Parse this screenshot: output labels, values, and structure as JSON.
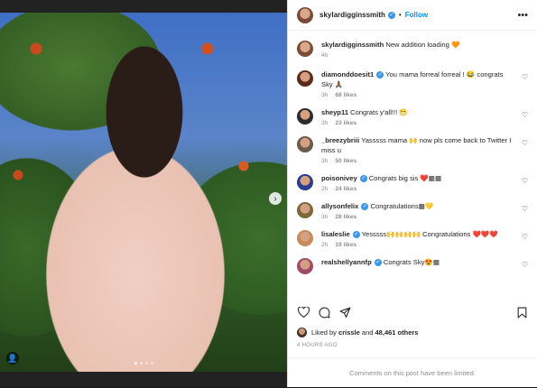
{
  "post": {
    "username": "skylardigginssmith",
    "follow_label": "Follow",
    "dot": "•",
    "more": "•••"
  },
  "caption": {
    "username": "skylardigginssmith",
    "text": "New addition loading 🧡",
    "time": "4h"
  },
  "comments": [
    {
      "username": "diamonddoesit1",
      "verified": true,
      "text": "You mama forreal forreal ! 😂 congrats Sky 🙏🏾",
      "time": "3h",
      "likes": "68 likes",
      "avatar_color": "#5a2a1a"
    },
    {
      "username": "sheyp11",
      "verified": false,
      "text": "Congrats y'all!!! 😁",
      "time": "3h",
      "likes": "23 likes",
      "avatar_color": "#2b2b2b"
    },
    {
      "username": "_breezybriii",
      "verified": false,
      "text": "Yasssss mama 🙌 now pls come back to Twitter I miss u",
      "time": "3h",
      "likes": "50 likes",
      "avatar_color": "#6b5a4a"
    },
    {
      "username": "poisonivey",
      "verified": true,
      "text": "Congrats big sis ❤️▦▦",
      "time": "2h",
      "likes": "24 likes",
      "avatar_color": "#2a3d8f"
    },
    {
      "username": "allysonfelix",
      "verified": true,
      "text": "Congratulations▦💛",
      "time": "3h",
      "likes": "28 likes",
      "avatar_color": "#7a6a3a"
    },
    {
      "username": "lisaleslie",
      "verified": true,
      "text": "Yesssss🙌🙌🙌🙌 Congratulations ❤️❤️❤️",
      "time": "2h",
      "likes": "19 likes",
      "avatar_color": "#c88a5a"
    },
    {
      "username": "realshellyannfp",
      "verified": true,
      "text": "Congrats Sky😍▦",
      "time": "",
      "likes": "",
      "avatar_color": "#a04a6a"
    }
  ],
  "liked_by": {
    "prefix": "Liked by",
    "user": "crissle",
    "connector": "and",
    "count": "48,461 others"
  },
  "timestamp": "4 HOURS AGO",
  "comments_limited": "Comments on this post have been limited.",
  "colors": {
    "accent": "#0095f6",
    "verified": "#3897f0"
  },
  "icons": [
    "heart-icon",
    "comment-icon",
    "share-icon",
    "bookmark-icon",
    "more-icon",
    "chevron-right-icon",
    "user-tag-icon",
    "verified-icon"
  ]
}
